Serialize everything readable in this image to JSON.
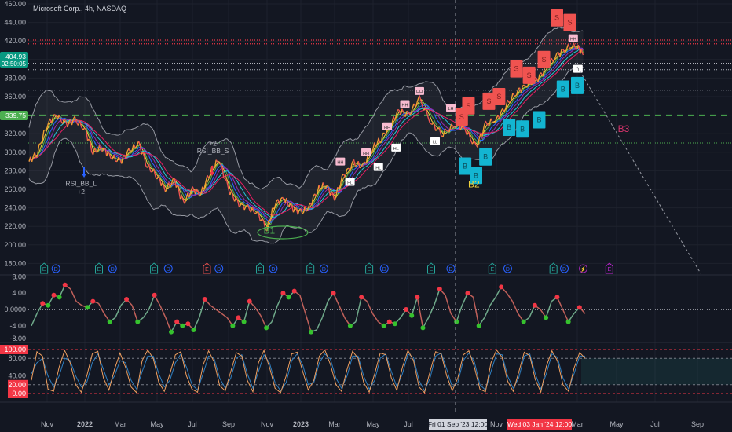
{
  "header": {
    "title": "Microsoft Corp., 4h, NASDAQ"
  },
  "price_tags": {
    "current": "404.93",
    "countdown": "02:50:05",
    "level": "339.75"
  },
  "crosshair": {
    "label": "Fri 01 Sep '23  12:00",
    "date": "2023-09-01"
  },
  "highlight": {
    "label": "Wed 03 Jan '24  12:00"
  },
  "colors": {
    "bg": "#131722",
    "up": "#26a69a",
    "down": "#ef5350",
    "level": "#4caf50",
    "sell": "#f05350",
    "buy": "#13b5d1",
    "accent": "#2962ff"
  },
  "chart_data": [
    {
      "type": "line",
      "title": "Microsoft Corp., 4h, NASDAQ",
      "ylim": [
        180,
        460
      ],
      "yticks": [
        "460.00",
        "440.00",
        "420.00",
        "400.00",
        "380.00",
        "360.00",
        "340.00",
        "320.00",
        "300.00",
        "280.00",
        "260.00",
        "240.00",
        "220.00",
        "200.00",
        "180.00"
      ],
      "xticks": [
        {
          "label": "Nov",
          "m": 1
        },
        {
          "label": "2022",
          "m": 3
        },
        {
          "label": "Mar",
          "m": 5
        },
        {
          "label": "May",
          "m": 7
        },
        {
          "label": "Jul",
          "m": 9
        },
        {
          "label": "Sep",
          "m": 11
        },
        {
          "label": "Nov",
          "m": 13
        },
        {
          "label": "2023",
          "m": 15
        },
        {
          "label": "Mar",
          "m": 17
        },
        {
          "label": "May",
          "m": 19
        },
        {
          "label": "Jul",
          "m": 21
        },
        {
          "label": "Nov",
          "m": 25
        },
        {
          "label": "Mar",
          "m": 29
        },
        {
          "label": "May",
          "m": 31
        },
        {
          "label": "Jul",
          "m": 33
        },
        {
          "label": "Sep",
          "m": 35
        }
      ],
      "series": [
        {
          "name": "MSFT close",
          "points": [
            [
              "2021-10-01",
              290
            ],
            [
              "2021-10-15",
              300
            ],
            [
              "2021-11-01",
              330
            ],
            [
              "2021-11-15",
              340
            ],
            [
              "2021-12-01",
              330
            ],
            [
              "2021-12-15",
              335
            ],
            [
              "2022-01-01",
              325
            ],
            [
              "2022-01-15",
              300
            ],
            [
              "2022-02-01",
              305
            ],
            [
              "2022-02-15",
              295
            ],
            [
              "2022-03-01",
              290
            ],
            [
              "2022-03-15",
              300
            ],
            [
              "2022-04-01",
              310
            ],
            [
              "2022-04-15",
              285
            ],
            [
              "2022-05-01",
              275
            ],
            [
              "2022-05-15",
              260
            ],
            [
              "2022-06-01",
              270
            ],
            [
              "2022-06-15",
              245
            ],
            [
              "2022-07-01",
              260
            ],
            [
              "2022-07-15",
              255
            ],
            [
              "2022-08-01",
              280
            ],
            [
              "2022-08-15",
              292
            ],
            [
              "2022-09-01",
              260
            ],
            [
              "2022-09-15",
              245
            ],
            [
              "2022-10-01",
              240
            ],
            [
              "2022-10-15",
              235
            ],
            [
              "2022-11-01",
              218
            ],
            [
              "2022-11-15",
              245
            ],
            [
              "2022-12-01",
              250
            ],
            [
              "2022-12-15",
              240
            ],
            [
              "2023-01-01",
              235
            ],
            [
              "2023-01-15",
              240
            ],
            [
              "2023-02-01",
              260
            ],
            [
              "2023-02-15",
              265
            ],
            [
              "2023-03-01",
              250
            ],
            [
              "2023-03-15",
              275
            ],
            [
              "2023-04-01",
              288
            ],
            [
              "2023-04-15",
              285
            ],
            [
              "2023-05-01",
              305
            ],
            [
              "2023-05-15",
              315
            ],
            [
              "2023-06-01",
              330
            ],
            [
              "2023-06-15",
              345
            ],
            [
              "2023-07-01",
              340
            ],
            [
              "2023-07-15",
              358
            ],
            [
              "2023-08-01",
              330
            ],
            [
              "2023-08-15",
              320
            ],
            [
              "2023-09-01",
              330
            ],
            [
              "2023-09-15",
              325
            ],
            [
              "2023-10-01",
              305
            ],
            [
              "2023-10-15",
              330
            ],
            [
              "2023-11-01",
              335
            ],
            [
              "2023-11-15",
              350
            ],
            [
              "2023-12-01",
              365
            ],
            [
              "2023-12-15",
              372
            ],
            [
              "2024-01-01",
              378
            ],
            [
              "2024-01-15",
              390
            ],
            [
              "2024-02-01",
              405
            ],
            [
              "2024-02-15",
              412
            ],
            [
              "2024-03-01",
              415
            ],
            [
              "2024-03-10",
              405
            ]
          ]
        }
      ],
      "levels": [
        {
          "value": 421,
          "style": "red-dotted"
        },
        {
          "value": 417,
          "style": "red-dotted"
        },
        {
          "value": 396,
          "style": "white-dotted"
        },
        {
          "value": 389,
          "style": "white-dotted"
        },
        {
          "value": 367,
          "style": "white-dotted"
        },
        {
          "value": 339.75,
          "style": "green-dashed"
        },
        {
          "value": 310,
          "style": "green-dotted"
        }
      ],
      "annotations": [
        {
          "text": "B1",
          "date": "2022-11-05",
          "price": 212,
          "color": "#4caf50"
        },
        {
          "text": "B2",
          "date": "2023-09-28",
          "price": 262,
          "color": "#f0d33c"
        },
        {
          "text": "B3",
          "date": "2024-05-12",
          "price": 322,
          "color": "#d6336c"
        },
        {
          "text": "RSI_BB_L",
          "date": "2021-12-25",
          "price": 264,
          "color": "#b2b5be"
        },
        {
          "text": "+2",
          "date": "2021-12-25",
          "price": 255,
          "color": "#b2b5be"
        },
        {
          "text": "+2",
          "date": "2022-08-05",
          "price": 307,
          "color": "#b2b5be"
        },
        {
          "text": "RSI_BB_S",
          "date": "2022-08-05",
          "price": 299,
          "color": "#b2b5be"
        }
      ],
      "signals": [
        {
          "date": "2023-03-10",
          "price": 290,
          "label": "HH",
          "kind": "hh"
        },
        {
          "date": "2023-03-25",
          "price": 268,
          "label": "HL",
          "kind": "hl"
        },
        {
          "date": "2023-04-20",
          "price": 300,
          "label": "HH",
          "kind": "hh"
        },
        {
          "date": "2023-05-10",
          "price": 284,
          "label": "HL",
          "kind": "hl"
        },
        {
          "date": "2023-05-25",
          "price": 328,
          "label": "HH",
          "kind": "hh"
        },
        {
          "date": "2023-06-10",
          "price": 305,
          "label": "HL",
          "kind": "hl"
        },
        {
          "date": "2023-06-25",
          "price": 352,
          "label": "HH",
          "kind": "hh"
        },
        {
          "date": "2023-07-15",
          "price": 366,
          "label": "HH",
          "kind": "hh"
        },
        {
          "date": "2023-08-05",
          "price": 312,
          "label": "LL",
          "kind": "ll"
        },
        {
          "date": "2023-08-25",
          "price": 348,
          "label": "LH",
          "kind": "lh"
        },
        {
          "date": "2023-09-10",
          "price": 338,
          "label": "S",
          "kind": "sell"
        },
        {
          "date": "2023-09-20",
          "price": 350,
          "label": "S",
          "kind": "sell"
        },
        {
          "date": "2023-09-15",
          "price": 285,
          "label": "B",
          "kind": "buy"
        },
        {
          "date": "2023-10-01",
          "price": 275,
          "label": "B",
          "kind": "buy"
        },
        {
          "date": "2023-10-15",
          "price": 295,
          "label": "B",
          "kind": "buy"
        },
        {
          "date": "2023-10-20",
          "price": 355,
          "label": "S",
          "kind": "sell"
        },
        {
          "date": "2023-11-05",
          "price": 360,
          "label": "S",
          "kind": "sell"
        },
        {
          "date": "2023-11-20",
          "price": 327,
          "label": "B",
          "kind": "buy"
        },
        {
          "date": "2023-12-01",
          "price": 390,
          "label": "S",
          "kind": "sell"
        },
        {
          "date": "2023-12-20",
          "price": 383,
          "label": "S",
          "kind": "sell"
        },
        {
          "date": "2023-12-10",
          "price": 325,
          "label": "B",
          "kind": "buy"
        },
        {
          "date": "2024-01-05",
          "price": 335,
          "label": "B",
          "kind": "buy"
        },
        {
          "date": "2024-01-12",
          "price": 400,
          "label": "S",
          "kind": "sell"
        },
        {
          "date": "2024-02-01",
          "price": 445,
          "label": "S",
          "kind": "sell"
        },
        {
          "date": "2024-02-20",
          "price": 440,
          "label": "S",
          "kind": "sell"
        },
        {
          "date": "2024-02-10",
          "price": 368,
          "label": "B",
          "kind": "buy"
        },
        {
          "date": "2024-03-01",
          "price": 372,
          "label": "B",
          "kind": "buy"
        },
        {
          "date": "2024-02-25",
          "price": 423,
          "label": "HH",
          "kind": "hh"
        },
        {
          "date": "2024-03-02",
          "price": 390,
          "label": "LL",
          "kind": "ll"
        }
      ],
      "events": [
        {
          "type": "E",
          "date": "2021-10-26",
          "color": "#26a69a"
        },
        {
          "type": "D",
          "date": "2021-11-15",
          "color": "#2962ff"
        },
        {
          "type": "E",
          "date": "2022-01-25",
          "color": "#26a69a"
        },
        {
          "type": "D",
          "date": "2022-02-18",
          "color": "#2962ff"
        },
        {
          "type": "E",
          "date": "2022-04-26",
          "color": "#26a69a"
        },
        {
          "type": "D",
          "date": "2022-05-20",
          "color": "#2962ff"
        },
        {
          "type": "E",
          "date": "2022-07-25",
          "color": "#ef5350"
        },
        {
          "type": "D",
          "date": "2022-08-15",
          "color": "#2962ff"
        },
        {
          "type": "E",
          "date": "2022-10-20",
          "color": "#26a69a"
        },
        {
          "type": "D",
          "date": "2022-11-12",
          "color": "#2962ff"
        },
        {
          "type": "E",
          "date": "2023-01-18",
          "color": "#26a69a"
        },
        {
          "type": "D",
          "date": "2023-02-12",
          "color": "#2962ff"
        },
        {
          "type": "E",
          "date": "2023-04-25",
          "color": "#26a69a"
        },
        {
          "type": "D",
          "date": "2023-05-20",
          "color": "#2962ff"
        },
        {
          "type": "E",
          "date": "2023-07-30",
          "color": "#26a69a"
        },
        {
          "type": "D",
          "date": "2023-08-25",
          "color": "#2962ff"
        },
        {
          "type": "E",
          "date": "2023-10-25",
          "color": "#26a69a"
        },
        {
          "type": "D",
          "date": "2023-11-18",
          "color": "#2962ff"
        },
        {
          "type": "E",
          "date": "2024-01-26",
          "color": "#26a69a"
        },
        {
          "type": "D",
          "date": "2024-02-12",
          "color": "#2962ff"
        },
        {
          "type": "⚡",
          "date": "2024-03-10",
          "color": "#9c27b0"
        },
        {
          "type": "E",
          "date": "2024-04-20",
          "color": "#c026d3"
        }
      ]
    },
    {
      "type": "line",
      "title": "Oscillator",
      "ylim": [
        -8,
        8
      ],
      "yticks": [
        "8.00",
        "4.00",
        "0.0000",
        "-4.00",
        "-8.00"
      ],
      "values": [
        -4,
        -1,
        1.5,
        1,
        3.5,
        3,
        6,
        5,
        2,
        1,
        0.5,
        2,
        1.5,
        -1,
        -3,
        -2,
        1,
        2.5,
        1,
        -3,
        -2,
        0,
        3.5,
        1,
        -2,
        -5.5,
        -3,
        -4,
        -3.5,
        -5,
        -2,
        2.5,
        1,
        0,
        -1,
        -2,
        -4,
        -2,
        -3,
        2,
        0.5,
        -1.5,
        -4.5,
        -3,
        1,
        4,
        3,
        4.5,
        3.5,
        -1,
        -5.5,
        -5,
        -2,
        2,
        4,
        1,
        -2,
        -4,
        -3,
        3,
        2,
        -1,
        -3,
        -4,
        -3,
        -3.5,
        -2,
        0,
        -1.5,
        3,
        -4.5,
        -2,
        1,
        5,
        3.5,
        -1,
        -3,
        1,
        4,
        3,
        -4,
        -2,
        1,
        3,
        5.5,
        4,
        2,
        -1,
        -3,
        -2,
        1,
        0,
        -2,
        2,
        3,
        0,
        -3,
        -1,
        0.5,
        -1
      ],
      "baseline": 0
    },
    {
      "type": "line",
      "title": "Stochastic",
      "ylim": [
        0,
        100
      ],
      "yticks": [
        "100.00",
        "80.00",
        "40.00",
        "20.00",
        "0.00"
      ],
      "bands": [
        20,
        80
      ],
      "series": [
        {
          "name": "%K",
          "color": "#f0a060",
          "values": [
            30,
            95,
            85,
            10,
            5,
            60,
            98,
            70,
            20,
            3,
            40,
            90,
            96,
            35,
            8,
            55,
            92,
            60,
            15,
            2,
            75,
            99,
            80,
            25,
            5,
            45,
            88,
            95,
            40,
            10,
            3,
            65,
            97,
            72,
            18,
            6,
            50,
            93,
            85,
            30,
            4,
            70,
            98,
            60,
            12,
            2,
            40,
            90,
            94,
            50,
            8,
            30,
            85,
            99,
            66,
            20,
            5,
            55,
            96,
            80,
            25,
            3,
            45,
            92,
            88,
            35,
            7,
            60,
            98,
            75,
            15,
            2,
            50,
            95,
            90,
            40,
            6,
            35,
            88,
            97,
            60,
            10,
            4,
            70,
            99,
            82,
            28,
            5,
            48,
            94,
            86,
            32,
            3,
            62,
            97,
            74,
            20,
            5,
            58,
            93,
            80
          ]
        },
        {
          "name": "%D",
          "color": "#2f7fc0",
          "values": [
            45,
            70,
            80,
            40,
            15,
            40,
            80,
            75,
            40,
            15,
            25,
            70,
            90,
            55,
            20,
            40,
            75,
            70,
            30,
            10,
            50,
            85,
            85,
            45,
            15,
            30,
            70,
            90,
            60,
            20,
            8,
            45,
            85,
            80,
            35,
            12,
            35,
            80,
            88,
            45,
            12,
            50,
            88,
            70,
            25,
            6,
            25,
            75,
            90,
            65,
            20,
            25,
            70,
            90,
            78,
            35,
            12,
            40,
            85,
            85,
            40,
            10,
            30,
            80,
            90,
            50,
            15,
            45,
            90,
            82,
            30,
            6,
            35,
            85,
            92,
            55,
            15,
            25,
            75,
            92,
            72,
            20,
            8,
            50,
            90,
            88,
            40,
            12,
            35,
            85,
            90,
            45,
            10,
            45,
            90,
            82,
            35,
            10,
            45,
            85,
            85
          ]
        }
      ]
    }
  ]
}
